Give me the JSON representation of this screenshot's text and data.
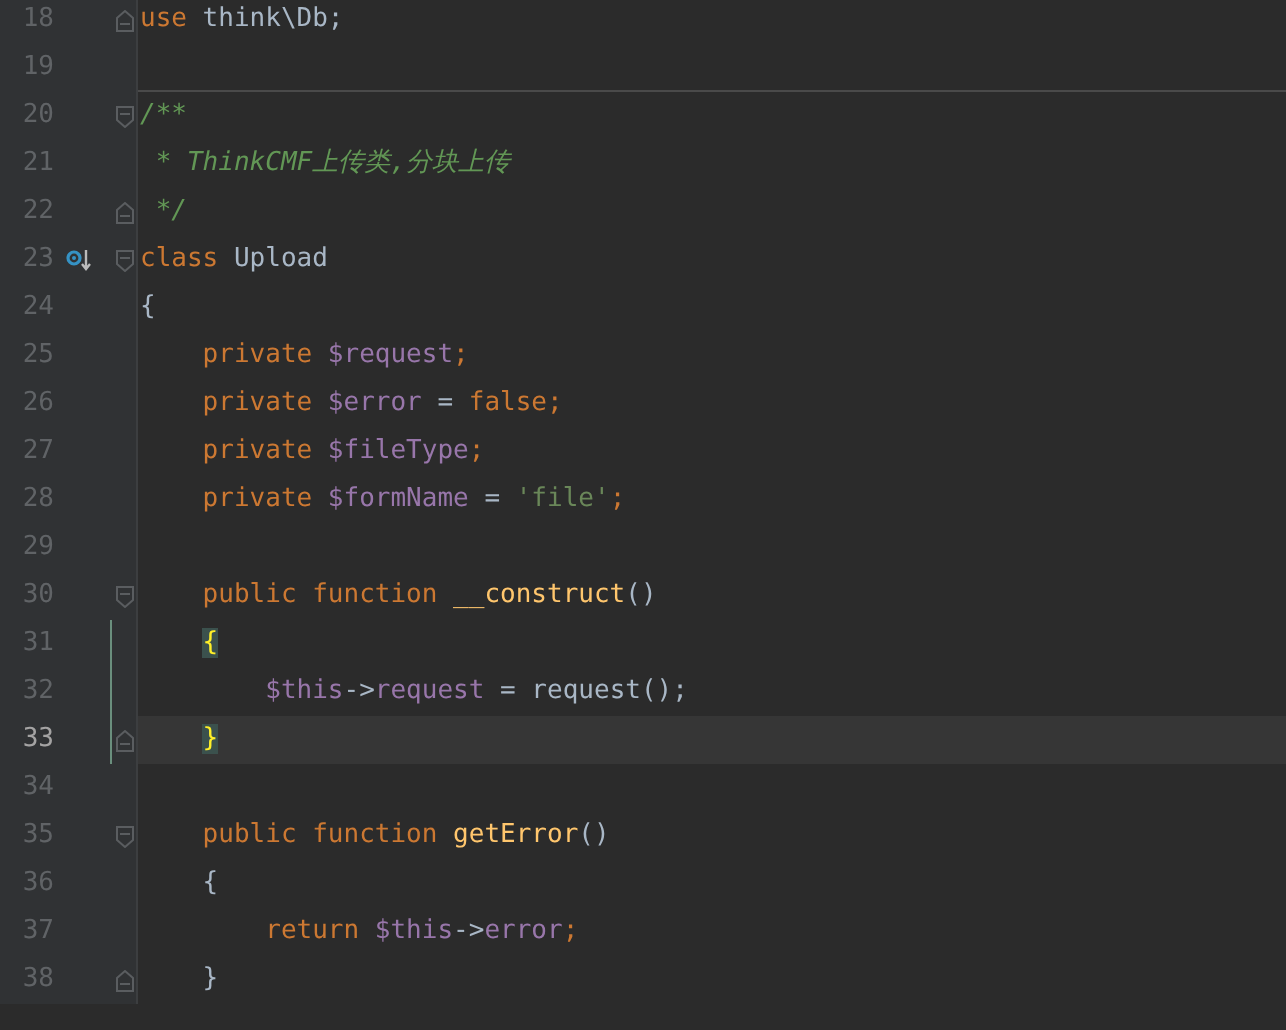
{
  "editor": {
    "lines": [
      {
        "number": "18",
        "fold_end": true,
        "tokens": [
          {
            "kind": "keyword",
            "text": "use"
          },
          {
            "kind": "plain",
            "text": " think\\Db;"
          }
        ]
      },
      {
        "number": "19",
        "separator_below": true
      },
      {
        "number": "20",
        "fold_start": true,
        "tokens": [
          {
            "kind": "comment",
            "text": "/**"
          }
        ]
      },
      {
        "number": "21",
        "tokens": [
          {
            "kind": "comment",
            "text": " * ThinkCMF上传类,分块上传"
          }
        ]
      },
      {
        "number": "22",
        "fold_end": true,
        "tokens": [
          {
            "kind": "comment",
            "text": " */"
          }
        ]
      },
      {
        "number": "23",
        "fold_start": true,
        "gutter_icon": true,
        "tokens": [
          {
            "kind": "keyword",
            "text": "class"
          },
          {
            "kind": "plain",
            "text": " Upload"
          }
        ]
      },
      {
        "number": "24",
        "tokens": [
          {
            "kind": "plain",
            "text": "{"
          }
        ]
      },
      {
        "number": "25",
        "tokens": [
          {
            "kind": "keyword",
            "text": "    private"
          },
          {
            "kind": "variable",
            "text": " $request"
          },
          {
            "kind": "keyword",
            "text": ";"
          }
        ]
      },
      {
        "number": "26",
        "tokens": [
          {
            "kind": "keyword",
            "text": "    private"
          },
          {
            "kind": "variable",
            "text": " $error"
          },
          {
            "kind": "plain",
            "text": " = "
          },
          {
            "kind": "keyword",
            "text": "false;"
          }
        ]
      },
      {
        "number": "27",
        "tokens": [
          {
            "kind": "keyword",
            "text": "    private"
          },
          {
            "kind": "variable",
            "text": " $fileType"
          },
          {
            "kind": "keyword",
            "text": ";"
          }
        ]
      },
      {
        "number": "28",
        "tokens": [
          {
            "kind": "keyword",
            "text": "    private"
          },
          {
            "kind": "variable",
            "text": " $formName"
          },
          {
            "kind": "plain",
            "text": " = "
          },
          {
            "kind": "string",
            "text": "'file'"
          },
          {
            "kind": "keyword",
            "text": ";"
          }
        ]
      },
      {
        "number": "29"
      },
      {
        "number": "30",
        "fold_start": true,
        "tokens": [
          {
            "kind": "keyword",
            "text": "    public function"
          },
          {
            "kind": "function",
            "text": " __construct"
          },
          {
            "kind": "plain",
            "text": "()"
          }
        ]
      },
      {
        "number": "31",
        "changed": true,
        "indented": true,
        "tokens": [
          {
            "kind": "matched_brace",
            "text": "{"
          }
        ]
      },
      {
        "number": "32",
        "changed": true,
        "tokens": [
          {
            "kind": "variable",
            "text": "        $this"
          },
          {
            "kind": "plain",
            "text": "->"
          },
          {
            "kind": "variable",
            "text": "request"
          },
          {
            "kind": "plain",
            "text": " = request();"
          }
        ]
      },
      {
        "number": "33",
        "current": true,
        "changed": true,
        "fold_end": true,
        "indented": true,
        "tokens": [
          {
            "kind": "matched_brace",
            "text": "}"
          }
        ]
      },
      {
        "number": "34"
      },
      {
        "number": "35",
        "fold_start": true,
        "tokens": [
          {
            "kind": "keyword",
            "text": "    public function"
          },
          {
            "kind": "function",
            "text": " getError"
          },
          {
            "kind": "plain",
            "text": "()"
          }
        ]
      },
      {
        "number": "36",
        "tokens": [
          {
            "kind": "plain",
            "text": "    {"
          }
        ]
      },
      {
        "number": "37",
        "tokens": [
          {
            "kind": "keyword",
            "text": "        return"
          },
          {
            "kind": "variable",
            "text": " $this"
          },
          {
            "kind": "plain",
            "text": "->"
          },
          {
            "kind": "variable",
            "text": "error"
          },
          {
            "kind": "keyword",
            "text": ";"
          }
        ]
      },
      {
        "number": "38",
        "fold_end": true,
        "tokens": [
          {
            "kind": "plain",
            "text": "    }"
          }
        ]
      }
    ]
  }
}
